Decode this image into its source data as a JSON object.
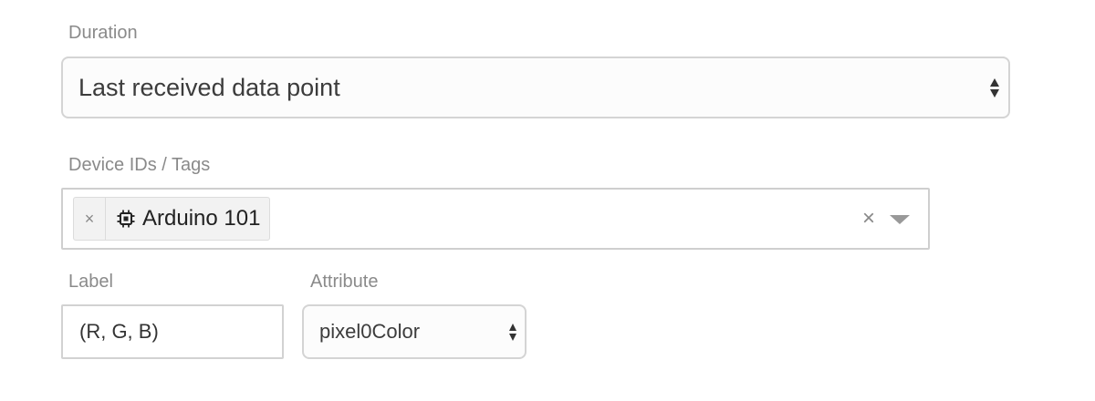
{
  "duration": {
    "label": "Duration",
    "selected": "Last received data point"
  },
  "devices": {
    "label": "Device IDs / Tags",
    "tags": [
      {
        "icon": "chip-icon",
        "text": "Arduino 101",
        "remove_symbol": "×"
      }
    ],
    "clear_symbol": "×"
  },
  "label_field": {
    "label": "Label",
    "value": "(R, G, B)"
  },
  "attribute": {
    "label": "Attribute",
    "selected": "pixel0Color"
  }
}
